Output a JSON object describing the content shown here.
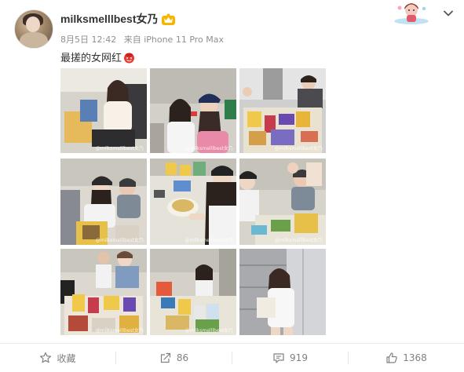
{
  "post": {
    "username": "milksmelllbest女乃",
    "date": "8月5日 12:42",
    "source": "来自 iPhone 11 Pro Max",
    "text": "最搓的女网红"
  },
  "photos": [
    {
      "watermark": "@milksmelllbest女乃"
    },
    {
      "watermark": "@milksmelllbest女乃"
    },
    {
      "watermark": "@milksmelllbest女乃"
    },
    {
      "watermark": "@milksmelllbest女乃"
    },
    {
      "watermark": "@milksmelllbest女乃"
    },
    {
      "watermark": "@milksmelllbest女乃"
    },
    {
      "watermark": "@milksmelllbest女乃"
    },
    {
      "watermark": "@milksmelllbest女乃"
    },
    {
      "watermark": ""
    }
  ],
  "actions": {
    "favorite": {
      "label": "收藏",
      "icon": "star-icon"
    },
    "repost": {
      "count": "86",
      "icon": "share-icon"
    },
    "comment": {
      "count": "919",
      "icon": "comment-icon"
    },
    "like": {
      "count": "1368",
      "icon": "thumbs-up-icon"
    }
  },
  "colors": {
    "accent": "#ff8200",
    "badge": "#f7b500",
    "text_muted": "#808080"
  }
}
